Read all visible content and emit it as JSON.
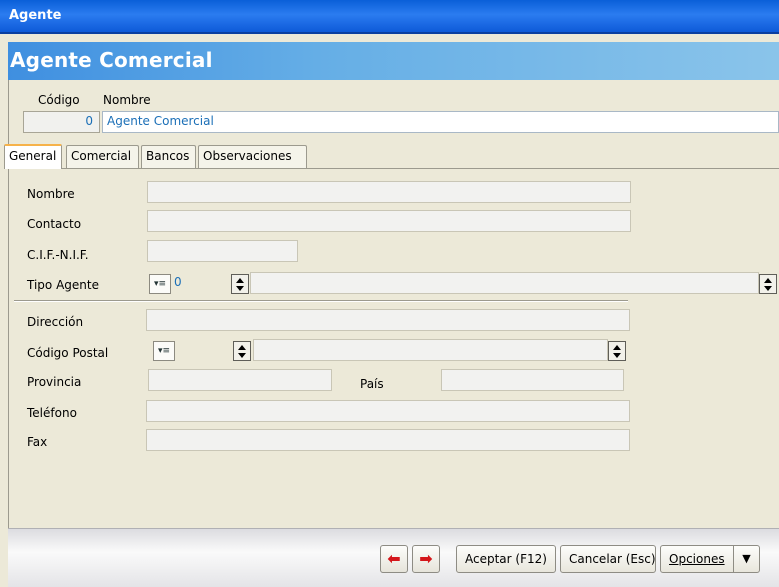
{
  "window": {
    "title": "Agente"
  },
  "header": {
    "title": "Agente Comercial"
  },
  "record": {
    "codigo_label": "Código",
    "nombre_label": "Nombre",
    "codigo_value": "0",
    "nombre_value": "Agente Comercial"
  },
  "tabs": [
    {
      "label": "General",
      "active": true
    },
    {
      "label": "Comercial",
      "active": false
    },
    {
      "label": "Bancos",
      "active": false
    },
    {
      "label": "Observaciones",
      "active": false
    }
  ],
  "fields": {
    "nombre": "Nombre",
    "contacto": "Contacto",
    "cif": "C.I.F.-N.I.F.",
    "tipo_agente": "Tipo Agente",
    "tipo_agente_value": "0",
    "direccion": "Dirección",
    "codigo_postal": "Código Postal",
    "provincia": "Provincia",
    "pais": "País",
    "telefono": "Teléfono",
    "fax": "Fax"
  },
  "footer": {
    "prev_icon": "arrow-left-icon",
    "next_icon": "arrow-right-icon",
    "aceptar": "Aceptar (F12)",
    "cancelar": "Cancelar (Esc)",
    "opciones": "Opciones"
  },
  "colors": {
    "title_bar": "#0a5fd8",
    "header_gradient_start": "#3f8fe0",
    "value_text": "#1b6fb7",
    "nav_arrow": "#d4161a",
    "active_tab_accent": "#f6b24a"
  }
}
